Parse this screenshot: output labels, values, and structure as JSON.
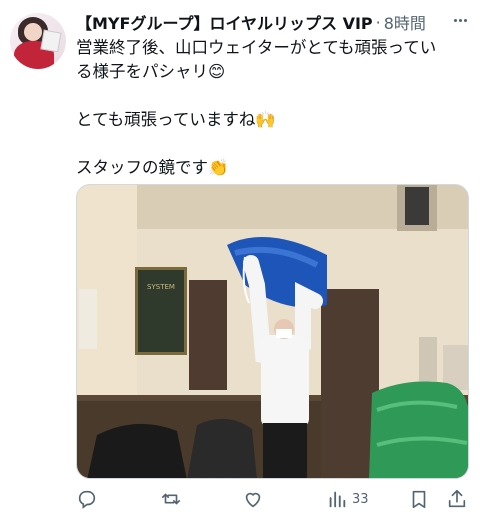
{
  "author": {
    "display_name": "【MYFグループ】ロイヤルリップス VIP",
    "time": "8時間"
  },
  "tweet": {
    "line1": "営業終了後、山口ウェイターがとても頑張ってい",
    "line2": "る様子をパシャリ😊",
    "line3": "とても頑張っていますね🙌",
    "line4": "スタッフの鏡です👏"
  },
  "media": {
    "sign_text": "SYSTEM"
  },
  "actions": {
    "views": "33"
  },
  "icons": [
    "reply-icon",
    "retweet-icon",
    "like-icon",
    "views-icon",
    "bookmark-icon",
    "share-icon",
    "more-icon"
  ],
  "colors": {
    "icon": "#536471",
    "text": "#0f1419"
  }
}
